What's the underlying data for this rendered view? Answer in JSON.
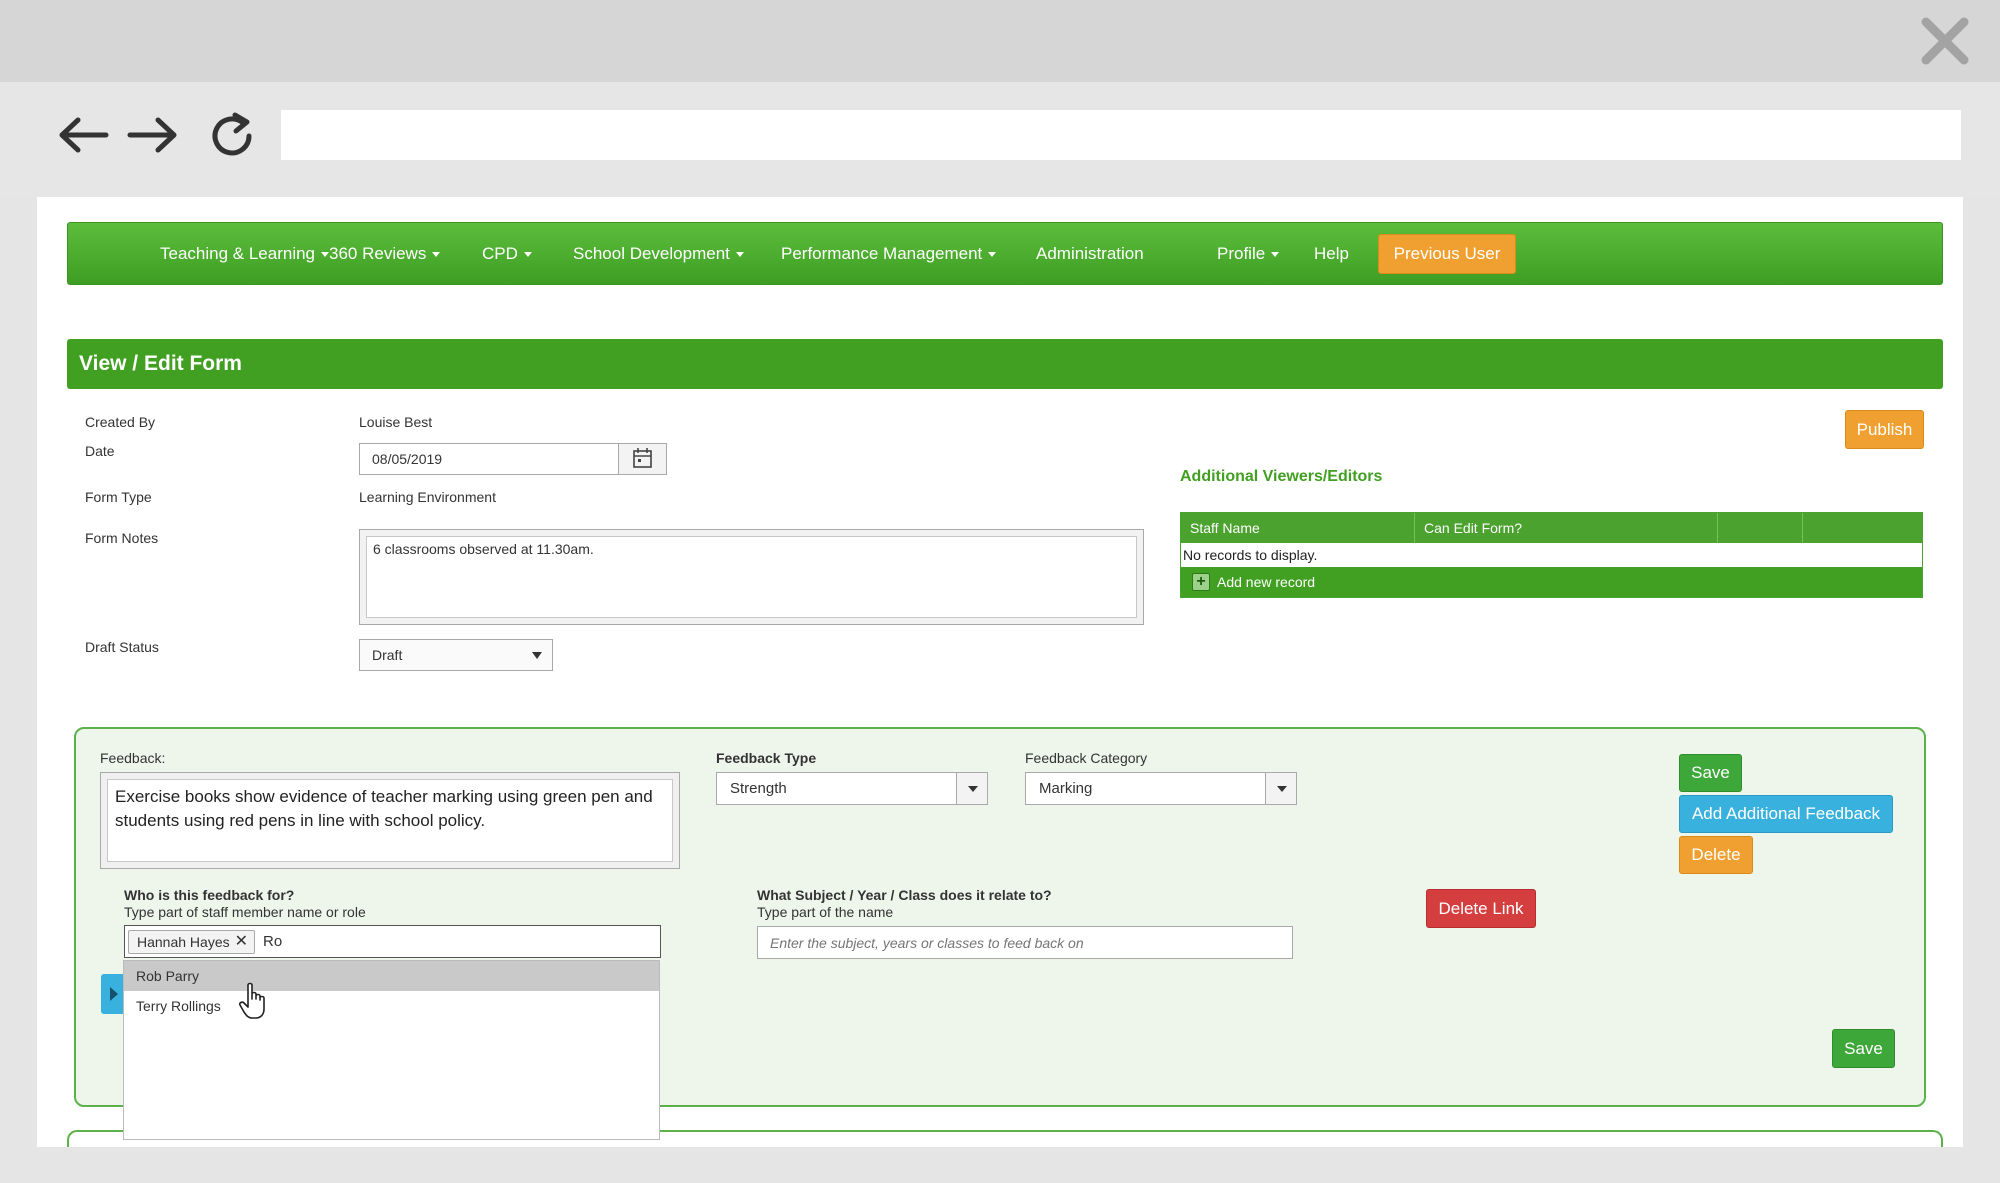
{
  "nav": {
    "items": [
      {
        "label": "Teaching & Learning",
        "caret": true
      },
      {
        "label": "360 Reviews",
        "caret": true
      },
      {
        "label": "CPD",
        "caret": true
      },
      {
        "label": "School Development",
        "caret": true
      },
      {
        "label": "Performance Management",
        "caret": true
      },
      {
        "label": "Administration",
        "caret": false
      },
      {
        "label": "Profile",
        "caret": true
      },
      {
        "label": "Help",
        "caret": false
      }
    ],
    "previous_user": "Previous User"
  },
  "form": {
    "title": "View / Edit Form",
    "created_by_label": "Created By",
    "created_by_value": "Louise Best",
    "date_label": "Date",
    "date_value": "08/05/2019",
    "form_type_label": "Form Type",
    "form_type_value": "Learning Environment",
    "notes_label": "Form Notes",
    "notes_value": "6 classrooms observed at 11.30am.",
    "draft_label": "Draft Status",
    "draft_value": "Draft",
    "publish": "Publish"
  },
  "viewers": {
    "title": "Additional Viewers/Editors",
    "columns": [
      "Staff Name",
      "Can Edit Form?"
    ],
    "empty": "No records to display.",
    "add": "Add new record"
  },
  "feedback": {
    "label": "Feedback:",
    "text": "Exercise books show evidence of teacher marking using green pen and students using red pens in line with school policy.",
    "type_label": "Feedback Type",
    "type_value": "Strength",
    "category_label": "Feedback Category",
    "category_value": "Marking",
    "save": "Save",
    "add_additional": "Add Additional Feedback",
    "delete": "Delete",
    "who_label": "Who is this feedback for?",
    "who_hint": "Type part of staff member name or role",
    "who_tag": "Hannah Hayes",
    "who_typed": "Ro",
    "suggestions": [
      "Rob Parry",
      "Terry Rollings"
    ],
    "subject_label": "What Subject / Year / Class does it relate to?",
    "subject_hint": "Type part of the name",
    "subject_placeholder": "Enter the subject, years or classes to feed back on",
    "delete_link": "Delete Link",
    "save_bottom": "Save"
  },
  "colors": {
    "nav_green": "#4aaa2c",
    "header_green": "#41a021",
    "orange": "#f0a030",
    "blue": "#39b1de",
    "red": "#d53e3e"
  }
}
